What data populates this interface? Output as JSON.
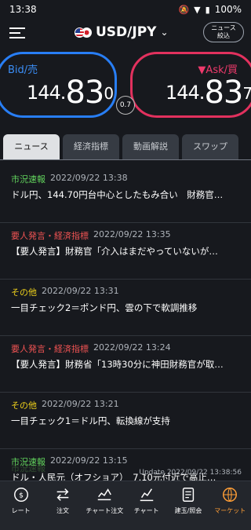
{
  "status": {
    "time": "13:38",
    "battery": "100%"
  },
  "header": {
    "pair": "USD/JPY",
    "news_filter": "ニュース\n絞込"
  },
  "quotes": {
    "bid_label": "Bid/売",
    "bid_prefix": "144.",
    "bid_big": "83",
    "bid_small": "0",
    "ask_label": "▼Ask/買",
    "ask_prefix": "144.",
    "ask_big": "83",
    "ask_small": "7",
    "spread": "0.7"
  },
  "tabs": [
    "ニュース",
    "経済指標",
    "動画解説",
    "スワップ"
  ],
  "news": [
    {
      "category": "市況速報",
      "time": "2022/09/22 13:38",
      "title": "ドル円、144.70円台中心としたもみ合い　財務官…",
      "color": "#62d45d"
    },
    {
      "category": "要人発言・経済指標",
      "time": "2022/09/22 13:35",
      "title": "【要人発言】財務官「介入はまだやっていないが…",
      "color": "#ef5353"
    },
    {
      "category": "その他",
      "time": "2022/09/22 13:31",
      "title": "一目チェック2＝ポンド円、雲の下で軟調推移",
      "color": "#f0d21b"
    },
    {
      "category": "要人発言・経済指標",
      "time": "2022/09/22 13:24",
      "title": "【要人発言】財務省「13時30分に神田財務官が取…",
      "color": "#ef5353"
    },
    {
      "category": "その他",
      "time": "2022/09/22 13:21",
      "title": "一目チェック1＝ドル円、転換線が支持",
      "color": "#f0d21b"
    },
    {
      "category": "市況速報",
      "time": "2022/09/22 13:15",
      "title": "ドル・人民元（オフショア）　7.10元付近で高止…",
      "color": "#62d45d"
    }
  ],
  "partial_item": "市況速報",
  "update_text": "Update 2022/09/22 13:38:56",
  "nav": [
    {
      "label": "レート",
      "icon": "rate-icon"
    },
    {
      "label": "注文",
      "icon": "order-icon"
    },
    {
      "label": "チャート注文",
      "icon": "chart-order-icon"
    },
    {
      "label": "チャート",
      "icon": "chart-icon"
    },
    {
      "label": "建玉/照会",
      "icon": "position-icon"
    },
    {
      "label": "マーケット",
      "icon": "market-icon"
    }
  ]
}
